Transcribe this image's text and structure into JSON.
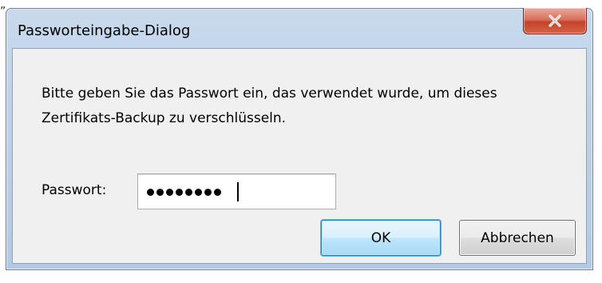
{
  "artifact": "„",
  "window": {
    "title": "Passworteingabe-Dialog"
  },
  "titlebar": {
    "close_icon": "close-x-icon"
  },
  "dialog": {
    "message": "Bitte geben Sie das Passwort ein, das verwendet wurde, um dieses Zertifikats-Backup zu verschlüsseln.",
    "password_label": "Passwort:",
    "password_masked_count": 8,
    "ok_label": "OK",
    "cancel_label": "Abbrechen"
  },
  "colors": {
    "client_bg": "#f0f0f0",
    "close_button": "#c5432a",
    "default_button_border": "#3c7fb1"
  }
}
